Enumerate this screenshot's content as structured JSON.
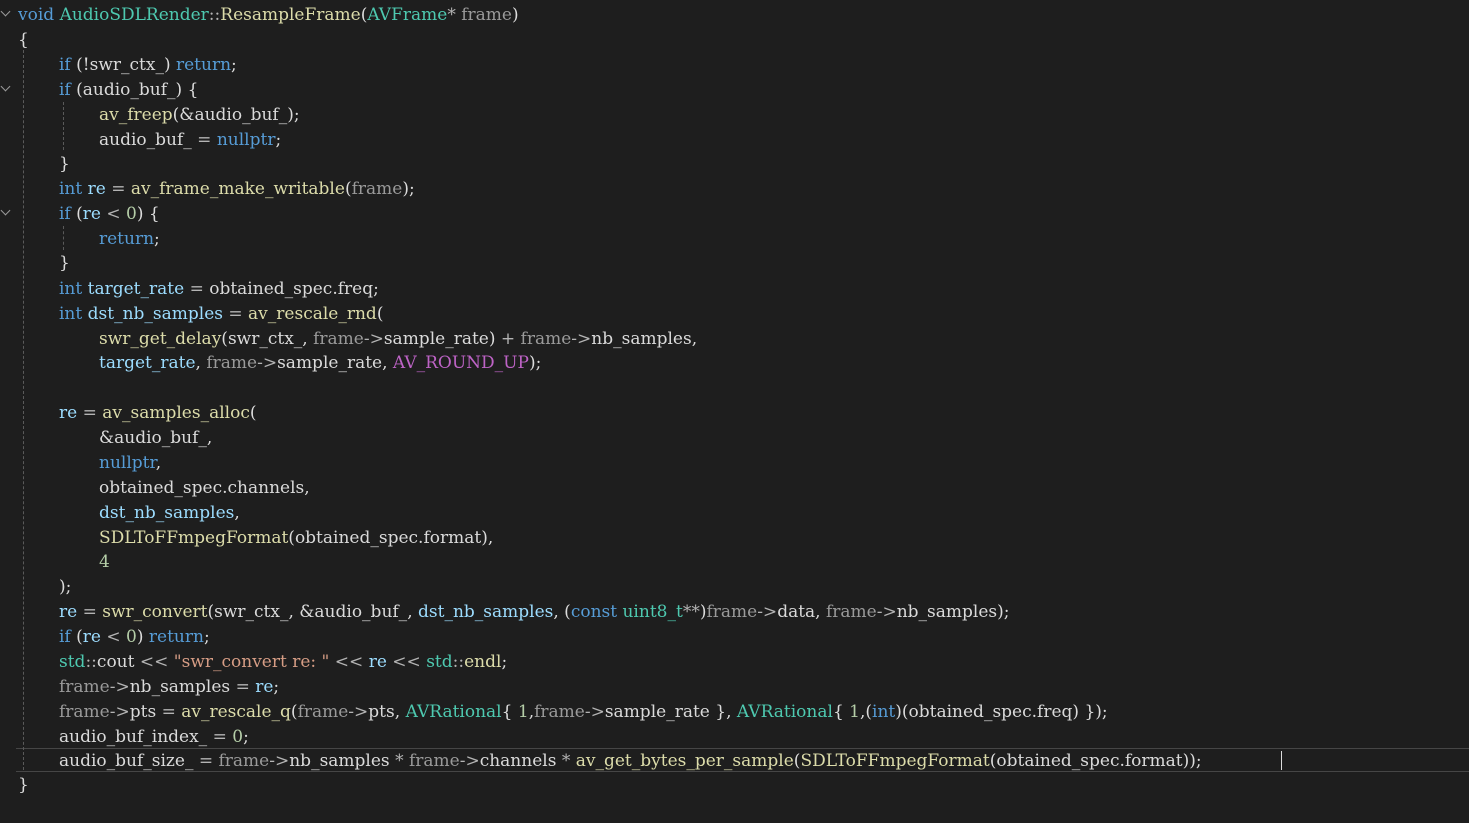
{
  "editor": {
    "language": "C++",
    "cursor": {
      "line": 31
    },
    "colors": {
      "background": "#1e1e1e",
      "keyword": "#569cd6",
      "function": "#dcdcaa",
      "type": "#4ec9b0",
      "parameter": "#9a9a9a",
      "local": "#9cdcfe",
      "number": "#b5cea8",
      "string": "#d69d85",
      "macro": "#bd63c5"
    },
    "lines": [
      [
        [
          "kw",
          "void "
        ],
        [
          "ty",
          "AudioSDLRender"
        ],
        [
          "op",
          "::"
        ],
        [
          "fn",
          "ResampleFrame"
        ],
        [
          "pl",
          "("
        ],
        [
          "ty",
          "AVFrame"
        ],
        [
          "op",
          "* "
        ],
        [
          "pm",
          "frame"
        ],
        [
          "pl",
          ")"
        ]
      ],
      [
        [
          "pl",
          "{"
        ]
      ],
      [
        [
          "kw",
          "if "
        ],
        [
          "pl",
          "(!"
        ],
        [
          "mb",
          "swr_ctx_"
        ],
        [
          "pl",
          ") "
        ],
        [
          "kw",
          "return"
        ],
        [
          "pl",
          ";"
        ]
      ],
      [
        [
          "kw",
          "if "
        ],
        [
          "pl",
          "("
        ],
        [
          "mb",
          "audio_buf_"
        ],
        [
          "pl",
          ") {"
        ]
      ],
      [
        [
          "fn",
          "av_freep"
        ],
        [
          "pl",
          "(&"
        ],
        [
          "mb",
          "audio_buf_"
        ],
        [
          "pl",
          ");"
        ]
      ],
      [
        [
          "mb",
          "audio_buf_ "
        ],
        [
          "op",
          "= "
        ],
        [
          "kw",
          "nullptr"
        ],
        [
          "pl",
          ";"
        ]
      ],
      [
        [
          "pl",
          "}"
        ]
      ],
      [
        [
          "kw",
          "int "
        ],
        [
          "lv",
          "re "
        ],
        [
          "op",
          "= "
        ],
        [
          "fn",
          "av_frame_make_writable"
        ],
        [
          "pl",
          "("
        ],
        [
          "pm",
          "frame"
        ],
        [
          "pl",
          ");"
        ]
      ],
      [
        [
          "kw",
          "if "
        ],
        [
          "pl",
          "("
        ],
        [
          "lv",
          "re "
        ],
        [
          "op",
          "< "
        ],
        [
          "num",
          "0"
        ],
        [
          "pl",
          ") {"
        ]
      ],
      [
        [
          "kw",
          "return"
        ],
        [
          "pl",
          ";"
        ]
      ],
      [
        [
          "pl",
          "}"
        ]
      ],
      [
        [
          "kw",
          "int "
        ],
        [
          "lv",
          "target_rate "
        ],
        [
          "op",
          "= "
        ],
        [
          "mb",
          "obtained_spec"
        ],
        [
          "pl",
          "."
        ],
        [
          "mb",
          "freq"
        ],
        [
          "pl",
          ";"
        ]
      ],
      [
        [
          "kw",
          "int "
        ],
        [
          "lv",
          "dst_nb_samples "
        ],
        [
          "op",
          "= "
        ],
        [
          "fn",
          "av_rescale_rnd"
        ],
        [
          "pl",
          "("
        ]
      ],
      [
        [
          "fn",
          "swr_get_delay"
        ],
        [
          "pl",
          "("
        ],
        [
          "mb",
          "swr_ctx_"
        ],
        [
          "pl",
          ", "
        ],
        [
          "pm",
          "frame"
        ],
        [
          "op",
          "->"
        ],
        [
          "mb",
          "sample_rate"
        ],
        [
          "pl",
          ") "
        ],
        [
          "op",
          "+ "
        ],
        [
          "pm",
          "frame"
        ],
        [
          "op",
          "->"
        ],
        [
          "mb",
          "nb_samples"
        ],
        [
          "pl",
          ","
        ]
      ],
      [
        [
          "lv",
          "target_rate"
        ],
        [
          "pl",
          ", "
        ],
        [
          "pm",
          "frame"
        ],
        [
          "op",
          "->"
        ],
        [
          "mb",
          "sample_rate"
        ],
        [
          "pl",
          ", "
        ],
        [
          "mac",
          "AV_ROUND_UP"
        ],
        [
          "pl",
          ");"
        ]
      ],
      [],
      [
        [
          "lv",
          "re "
        ],
        [
          "op",
          "= "
        ],
        [
          "fn",
          "av_samples_alloc"
        ],
        [
          "pl",
          "("
        ]
      ],
      [
        [
          "pl",
          "&"
        ],
        [
          "mb",
          "audio_buf_"
        ],
        [
          "pl",
          ","
        ]
      ],
      [
        [
          "kw",
          "nullptr"
        ],
        [
          "pl",
          ","
        ]
      ],
      [
        [
          "mb",
          "obtained_spec"
        ],
        [
          "pl",
          "."
        ],
        [
          "mb",
          "channels"
        ],
        [
          "pl",
          ","
        ]
      ],
      [
        [
          "lv",
          "dst_nb_samples"
        ],
        [
          "pl",
          ","
        ]
      ],
      [
        [
          "fn",
          "SDLToFFmpegFormat"
        ],
        [
          "pl",
          "("
        ],
        [
          "mb",
          "obtained_spec"
        ],
        [
          "pl",
          "."
        ],
        [
          "mb",
          "format"
        ],
        [
          "pl",
          "),"
        ]
      ],
      [
        [
          "num",
          "4"
        ]
      ],
      [
        [
          "pl",
          ");"
        ]
      ],
      [
        [
          "lv",
          "re "
        ],
        [
          "op",
          "= "
        ],
        [
          "fn",
          "swr_convert"
        ],
        [
          "pl",
          "("
        ],
        [
          "mb",
          "swr_ctx_"
        ],
        [
          "pl",
          ", &"
        ],
        [
          "mb",
          "audio_buf_"
        ],
        [
          "pl",
          ", "
        ],
        [
          "lv",
          "dst_nb_samples"
        ],
        [
          "pl",
          ", ("
        ],
        [
          "kw",
          "const "
        ],
        [
          "ty",
          "uint8_t"
        ],
        [
          "op",
          "**"
        ],
        [
          "pl",
          ")"
        ],
        [
          "pm",
          "frame"
        ],
        [
          "op",
          "->"
        ],
        [
          "mb",
          "data"
        ],
        [
          "pl",
          ", "
        ],
        [
          "pm",
          "frame"
        ],
        [
          "op",
          "->"
        ],
        [
          "mb",
          "nb_samples"
        ],
        [
          "pl",
          ");"
        ]
      ],
      [
        [
          "kw",
          "if "
        ],
        [
          "pl",
          "("
        ],
        [
          "lv",
          "re "
        ],
        [
          "op",
          "< "
        ],
        [
          "num",
          "0"
        ],
        [
          "pl",
          ") "
        ],
        [
          "kw",
          "return"
        ],
        [
          "pl",
          ";"
        ]
      ],
      [
        [
          "ty",
          "std"
        ],
        [
          "op",
          "::"
        ],
        [
          "mb",
          "cout "
        ],
        [
          "op",
          "<< "
        ],
        [
          "str",
          "\"swr_convert re: \" "
        ],
        [
          "op",
          "<< "
        ],
        [
          "lv",
          "re "
        ],
        [
          "op",
          "<< "
        ],
        [
          "ty",
          "std"
        ],
        [
          "op",
          "::"
        ],
        [
          "fn",
          "endl"
        ],
        [
          "pl",
          ";"
        ]
      ],
      [
        [
          "pm",
          "frame"
        ],
        [
          "op",
          "->"
        ],
        [
          "mb",
          "nb_samples "
        ],
        [
          "op",
          "= "
        ],
        [
          "lv",
          "re"
        ],
        [
          "pl",
          ";"
        ]
      ],
      [
        [
          "pm",
          "frame"
        ],
        [
          "op",
          "->"
        ],
        [
          "mb",
          "pts "
        ],
        [
          "op",
          "= "
        ],
        [
          "fn",
          "av_rescale_q"
        ],
        [
          "pl",
          "("
        ],
        [
          "pm",
          "frame"
        ],
        [
          "op",
          "->"
        ],
        [
          "mb",
          "pts"
        ],
        [
          "pl",
          ", "
        ],
        [
          "ty",
          "AVRational"
        ],
        [
          "pl",
          "{ "
        ],
        [
          "num",
          "1"
        ],
        [
          "pl",
          ","
        ],
        [
          "pm",
          "frame"
        ],
        [
          "op",
          "->"
        ],
        [
          "mb",
          "sample_rate "
        ],
        [
          "pl",
          "}, "
        ],
        [
          "ty",
          "AVRational"
        ],
        [
          "pl",
          "{ "
        ],
        [
          "num",
          "1"
        ],
        [
          "pl",
          ",("
        ],
        [
          "kw",
          "int"
        ],
        [
          "pl",
          ")("
        ],
        [
          "mb",
          "obtained_spec"
        ],
        [
          "pl",
          "."
        ],
        [
          "mb",
          "freq"
        ],
        [
          "pl",
          ") });"
        ]
      ],
      [
        [
          "mb",
          "audio_buf_index_ "
        ],
        [
          "op",
          "= "
        ],
        [
          "num",
          "0"
        ],
        [
          "pl",
          ";"
        ]
      ],
      [
        [
          "mb",
          "audio_buf_size_ "
        ],
        [
          "op",
          "= "
        ],
        [
          "pm",
          "frame"
        ],
        [
          "op",
          "->"
        ],
        [
          "mb",
          "nb_samples "
        ],
        [
          "op",
          "* "
        ],
        [
          "pm",
          "frame"
        ],
        [
          "op",
          "->"
        ],
        [
          "mb",
          "channels "
        ],
        [
          "op",
          "* "
        ],
        [
          "fn",
          "av_get_bytes_per_sample"
        ],
        [
          "pl",
          "("
        ],
        [
          "fn",
          "SDLToFFmpegFormat"
        ],
        [
          "pl",
          "("
        ],
        [
          "mb",
          "obtained_spec"
        ],
        [
          "pl",
          "."
        ],
        [
          "mb",
          "format"
        ],
        [
          "pl",
          "));"
        ]
      ],
      [
        [
          "pl",
          "}"
        ]
      ]
    ]
  }
}
